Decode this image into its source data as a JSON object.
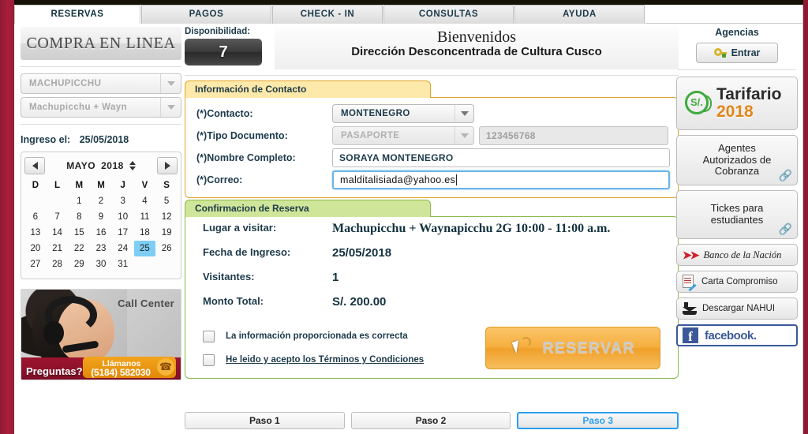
{
  "nav": {
    "tabs": [
      {
        "label": "RESERVAS",
        "active": true
      },
      {
        "label": "PAGOS",
        "active": false
      },
      {
        "label": "CHECK - IN",
        "active": false
      },
      {
        "label": "CONSULTAS",
        "active": false
      },
      {
        "label": "AYUDA",
        "active": false
      }
    ]
  },
  "left": {
    "logo": "COMPRA EN LINEA",
    "select_site": "MACHUPICCHU",
    "select_route": "Machupicchu + Wayn",
    "ingreso_label": "Ingreso el:",
    "ingreso_date": "25/05/2018",
    "calendar": {
      "month": "MAYO",
      "year": "2018",
      "dow": [
        "D",
        "L",
        "M",
        "M",
        "J",
        "V",
        "S"
      ],
      "lead_blanks": 2,
      "days": [
        1,
        2,
        3,
        4,
        5,
        6,
        7,
        8,
        9,
        10,
        11,
        12,
        13,
        14,
        15,
        16,
        17,
        18,
        19,
        20,
        21,
        22,
        23,
        24,
        25,
        26,
        27,
        28,
        29,
        30,
        31
      ],
      "selected": 25,
      "prev_label": "◀",
      "next_label": "▶"
    },
    "callcenter": {
      "title": "Call Center",
      "question": "Preguntas?",
      "call_label": "Llámanos",
      "phone": "(5184) 582030"
    }
  },
  "header": {
    "availability_label": "Disponibilidad:",
    "availability_value": "7",
    "welcome_line1": "Bienvenidos",
    "welcome_line2": "Dirección Desconcentrada de Cultura Cusco"
  },
  "contact": {
    "title": "Información de Contacto",
    "fields": [
      {
        "label": "(*)Contacto:",
        "value": "MONTENEGRO",
        "type": "select",
        "disabled": false
      },
      {
        "label": "(*)Tipo Documento:",
        "value": "PASAPORTE",
        "type": "select",
        "disabled": true,
        "doc_number": "123456768"
      },
      {
        "label": "(*)Nombre Completo:",
        "value": "SORAYA  MONTENEGRO",
        "type": "text",
        "disabled": false
      },
      {
        "label": "(*)Correo:",
        "value": "malditalisiada@yahoo.es",
        "type": "text",
        "disabled": false,
        "focused": true
      }
    ]
  },
  "confirm": {
    "title": "Confirmacion de Reserva",
    "rows": [
      {
        "label": "Lugar a visitar:",
        "value": "Machupicchu + Waynapicchu 2G 10:00 - 11:00 a.m."
      },
      {
        "label": "Fecha de Ingreso:",
        "value": "25/05/2018"
      },
      {
        "label": "Visitantes:",
        "value": "1"
      },
      {
        "label": "Monto Total:",
        "value": "S/. 200.00"
      }
    ],
    "check1": "La información proporcionada es correcta",
    "check2": "He leido y acepto los Términos y Condiciones",
    "reservar_label": "RESERVAR"
  },
  "steps": [
    {
      "label": "Paso 1",
      "active": false
    },
    {
      "label": "Paso 2",
      "active": false
    },
    {
      "label": "Paso 3",
      "active": true
    }
  ],
  "right": {
    "agencias_label": "Agencias",
    "entrar_label": "Entrar",
    "tarifario_line1": "Tarifario",
    "tarifario_line2": "2018",
    "tarifario_badge": "S/.",
    "agentes_label": "Agentes\nAutorizados de\nCobranza",
    "tickets_label": "Tickes para\nestudiantes",
    "banco_label": "Banco de la Nación",
    "carta_label": "Carta Compromiso",
    "nahui_label": "Descargar NAHUI",
    "facebook_label": "facebook.",
    "facebook_mark": "f"
  },
  "colors": {
    "frame": "#8e1a32",
    "orange_panel": "#e2a32b",
    "green_panel": "#8ab84a",
    "accent_blue": "#2b9ff0",
    "selected_day": "#7ecdf5",
    "reservar": "#f6ae3d",
    "facebook": "#3b5998"
  }
}
